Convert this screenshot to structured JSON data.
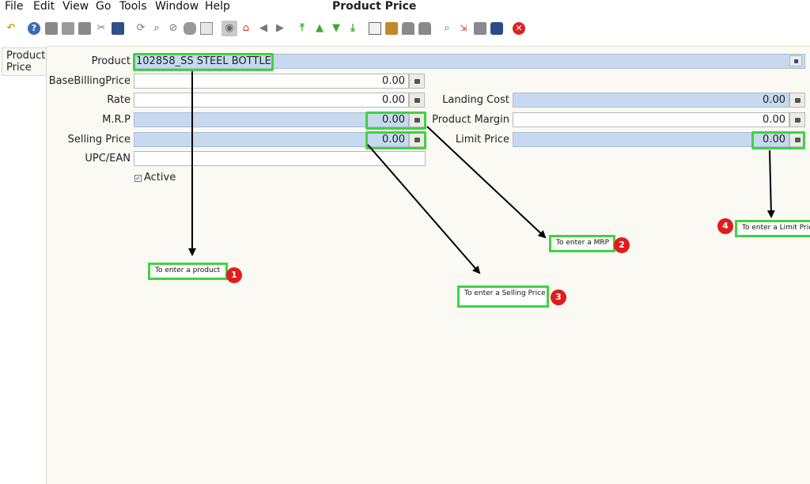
{
  "menu": {
    "items": [
      "File",
      "Edit",
      "View",
      "Go",
      "Tools",
      "Window",
      "Help"
    ],
    "title": "Product Price"
  },
  "toolbar": {
    "icons": [
      "undo-icon",
      "help-icon",
      "new-icon",
      "copy-icon",
      "delete-icon",
      "delete-selection-icon",
      "save-icon",
      "refresh-icon",
      "find-icon",
      "attachment-icon",
      "chat-icon",
      "grid-toggle-icon",
      "history-icon",
      "home-icon",
      "back-icon",
      "forward-icon",
      "first-record-icon",
      "previous-record-icon",
      "next-record-icon",
      "last-record-icon",
      "report-icon",
      "archive-icon",
      "print-preview-icon",
      "print-icon",
      "zoom-across-icon",
      "workflow-icon",
      "request-icon",
      "product-info-icon",
      "exit-icon"
    ],
    "accent": "#e02020"
  },
  "tab": {
    "label": "Product Price"
  },
  "form": {
    "product_label": "Product",
    "product_value": "102858_SS STEEL BOTTLE",
    "base_billing_label": "BaseBillingPrice",
    "base_billing_value": "0.00",
    "rate_label": "Rate",
    "rate_value": "0.00",
    "mrp_label": "M.R.P",
    "mrp_value": "0.00",
    "selling_label": "Selling Price",
    "selling_value": "0.00",
    "upc_label": "UPC/EAN",
    "upc_value": "",
    "active_label": "Active",
    "active_checked": true,
    "landing_label": "Landing Cost",
    "landing_value": "0.00",
    "margin_label": "Product Margin",
    "margin_value": "0.00",
    "limit_label": "Limit Price",
    "limit_value": "0.00"
  },
  "annotations": [
    {
      "number": "1",
      "text": "To enter a product"
    },
    {
      "number": "2",
      "text": "To enter a MRP"
    },
    {
      "number": "3",
      "text": "To enter a Selling Price"
    },
    {
      "number": "4",
      "text": "To enter a Limit Price"
    }
  ],
  "colors": {
    "highlight": "#3fd33f",
    "badge": "#e31b1b",
    "mandatory_field": "#c6d9ee"
  }
}
